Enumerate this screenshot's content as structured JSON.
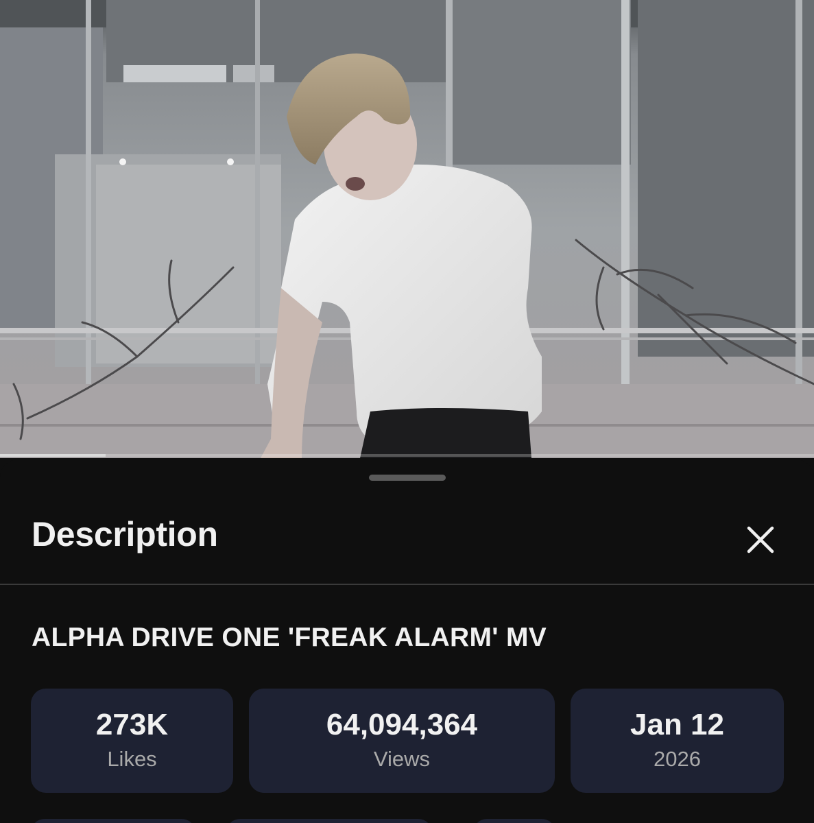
{
  "video": {
    "progress": 0.13
  },
  "description_panel": {
    "title": "Description",
    "close_icon": "close-icon",
    "video_title": "ALPHA DRIVE ONE 'FREAK ALARM' MV",
    "stats": {
      "likes": {
        "value": "273K",
        "label": "Likes"
      },
      "views": {
        "value": "64,094,364",
        "label": "Views"
      },
      "date": {
        "value": "Jan 12",
        "label": "2026"
      }
    }
  },
  "colors": {
    "background": "#0f0f0f",
    "stat_card": "#1e2233",
    "text_primary": "#f1f1f1",
    "text_secondary": "#aaaaaa"
  }
}
